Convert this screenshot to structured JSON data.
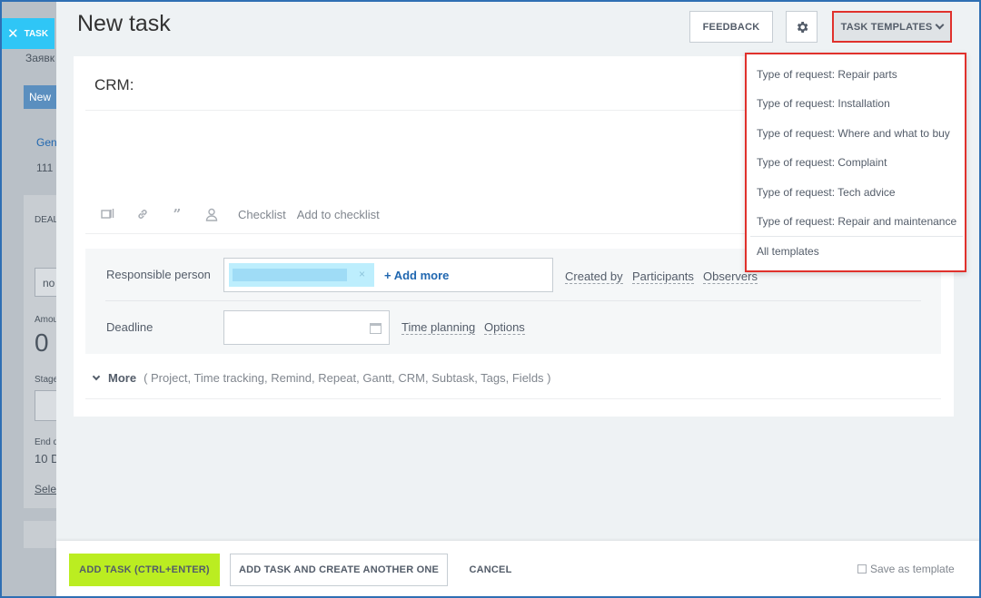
{
  "background": {
    "task_tab_label": "TASK",
    "text_1": "Заявк",
    "new_button": "New",
    "tab_fragment": "Gen",
    "number_fragment": "111",
    "deal_fragment": "DEAL",
    "field_value": "no",
    "amount_label": "Amou",
    "amount_value": "0",
    "stage_label": "Stage",
    "end_label": "End d",
    "end_value": "10 D",
    "select_fragment": "Selec"
  },
  "header": {
    "title": "New task",
    "feedback_label": "FEEDBACK",
    "templates_label": "TASK TEMPLATES"
  },
  "editor": {
    "crm_label": "CRM:",
    "checklist_label": "Checklist",
    "add_to_checklist_label": "Add to checklist"
  },
  "fields": {
    "responsible_label": "Responsible person",
    "chip_remove": "×",
    "add_more_label": "+ Add more",
    "created_by_label": "Created by",
    "participants_label": "Participants",
    "observers_label": "Observers",
    "deadline_label": "Deadline",
    "time_planning_label": "Time planning",
    "options_label": "Options"
  },
  "more": {
    "label": "More",
    "items": "( Project,  Time tracking,  Remind,  Repeat,  Gantt,  CRM,  Subtask,  Tags,  Fields )"
  },
  "templates_menu": {
    "items": [
      "Type of request: Repair parts",
      "Type of request: Installation",
      "Type of request: Where and what to buy",
      "Type of request: Complaint",
      "Type of request: Tech advice",
      "Type of request: Repair and maintenance"
    ],
    "all_templates_label": "All templates"
  },
  "footer": {
    "add_task_label": "ADD TASK (CTRL+ENTER)",
    "add_another_label": "ADD TASK AND CREATE ANOTHER ONE",
    "cancel_label": "CANCEL",
    "save_template_label": "Save as template"
  },
  "colors": {
    "accent_green": "#bbed21",
    "link_blue": "#2067b0",
    "highlight_red": "#e0312c",
    "task_tab": "#2fc6f6"
  }
}
